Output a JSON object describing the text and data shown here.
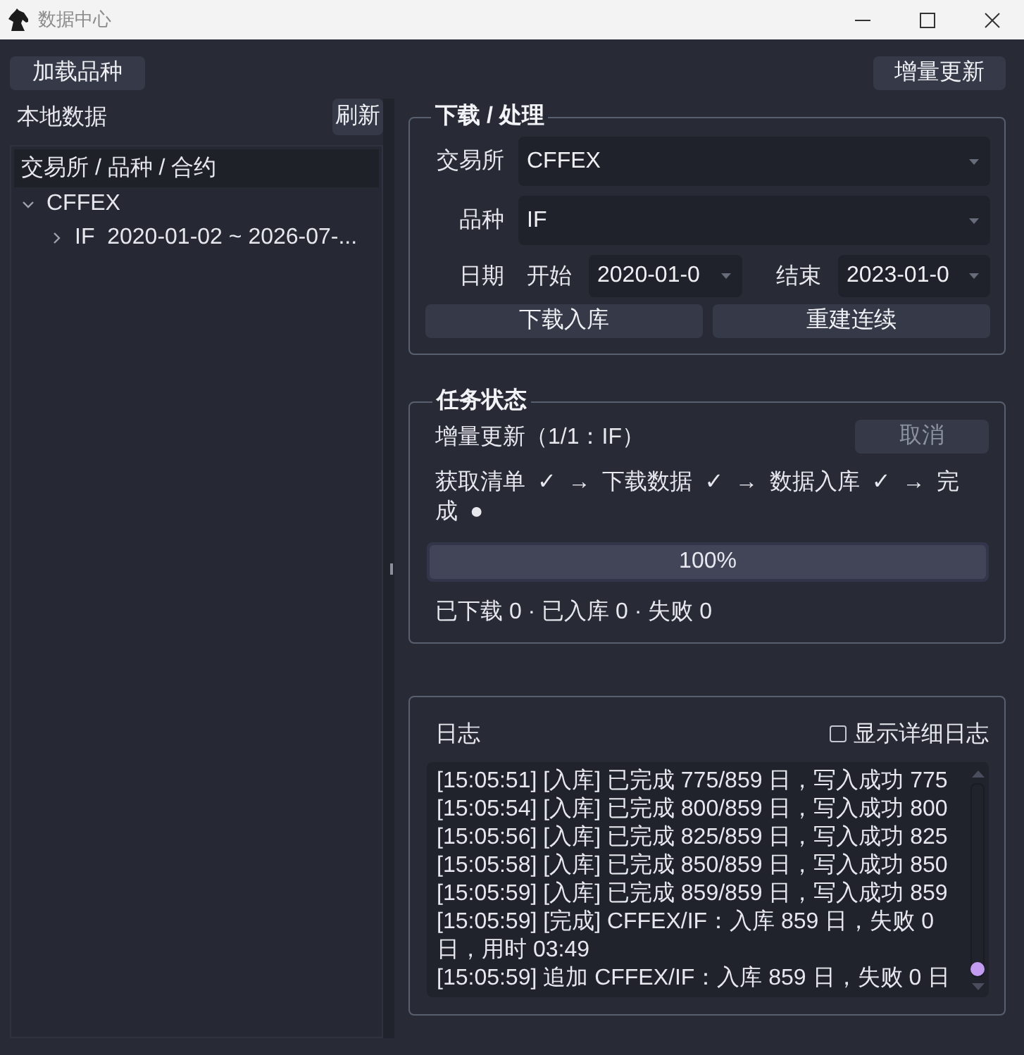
{
  "window": {
    "title": "数据中心"
  },
  "toolbar": {
    "load_button": "加载品种",
    "update_button": "增量更新"
  },
  "local_data": {
    "title": "本地数据",
    "refresh_button": "刷新",
    "tree": {
      "header": "交易所 / 品种 / 合约",
      "items": [
        {
          "label": "CFFEX",
          "expanded": true,
          "children": [
            {
              "label": "IF  2020-01-02 ~ 2026-07-...",
              "expanded": false
            }
          ]
        }
      ]
    }
  },
  "download": {
    "title": "下载 / 处理",
    "exchange": {
      "label": "交易所",
      "value": "CFFEX"
    },
    "product": {
      "label": "品种",
      "value": "IF"
    },
    "date": {
      "label": "日期",
      "start_label": "开始",
      "start_value": "2020-01-0",
      "end_label": "结束",
      "end_value": "2023-01-0"
    },
    "buttons": [
      "下载入库",
      "重建连续"
    ]
  },
  "task": {
    "title": "任务状态",
    "name": "增量更新（1/1：IF）",
    "cancel_button": {
      "label": "取消",
      "disabled": true
    },
    "steps": "获取清单 ✓ → 下载数据 ✓ → 数据入库 ✓ → 完成 ●",
    "progress": {
      "level": 1,
      "text": "100%"
    },
    "summary": "已下载 0 · 已入库 0 · 失败 0"
  },
  "log": {
    "title": "日志",
    "verbose_checkbox": {
      "label": "显示详细日志",
      "checked": false
    },
    "lines": [
      "[15:05:51] [入库] 已完成 775/859 日，写入成功 775",
      "[15:05:54] [入库] 已完成 800/859 日，写入成功 800",
      "[15:05:56] [入库] 已完成 825/859 日，写入成功 825",
      "[15:05:58] [入库] 已完成 850/859 日，写入成功 850",
      "[15:05:59] [入库] 已完成 859/859 日，写入成功 859",
      "[15:05:59] [完成] CFFEX/IF：入库 859 日，失败 0 日，用时 03:49",
      "[15:05:59] 追加 CFFEX/IF：入库 859 日，失败 0 日"
    ]
  }
}
